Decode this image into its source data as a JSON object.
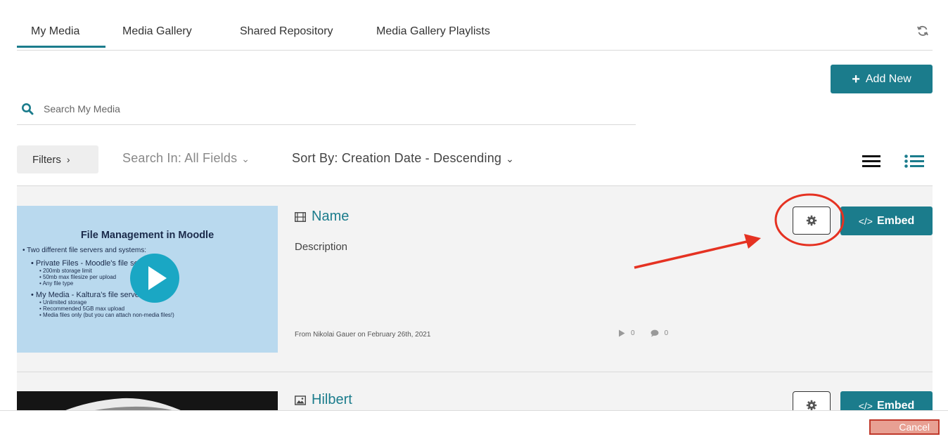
{
  "tabs": [
    {
      "label": "My Media",
      "active": true
    },
    {
      "label": "Media Gallery",
      "active": false
    },
    {
      "label": "Shared Repository",
      "active": false
    },
    {
      "label": "Media Gallery Playlists",
      "active": false
    }
  ],
  "toolbar": {
    "add_new_label": "Add New",
    "search_placeholder": "Search My Media",
    "filters_label": "Filters",
    "search_in_label": "Search In: All Fields",
    "sort_by_label": "Sort By: Creation Date - Descending"
  },
  "media": [
    {
      "title": "Name",
      "type_icon": "video-icon",
      "description": "Description",
      "from_text": "From Nikolai Gauer on February 26th, 2021",
      "plays": "0",
      "comments": "0",
      "embed_label": "Embed",
      "thumbnail": {
        "slide_title": "File Management in Moodle",
        "lines": [
          {
            "level": 1,
            "text": "Two different file servers and systems:"
          },
          {
            "level": 2,
            "text": "Private Files - Moodle's file server"
          },
          {
            "level": 3,
            "text": "200mb storage limit"
          },
          {
            "level": 3,
            "text": "50mb max filesize per upload"
          },
          {
            "level": 3,
            "text": "Any file type"
          },
          {
            "level": 2,
            "text": "My Media - Kaltura's file server"
          },
          {
            "level": 3,
            "text": "Unlimited storage"
          },
          {
            "level": 3,
            "text": "Recommended 5GB max upload"
          },
          {
            "level": 3,
            "text": "Media files only (but you can attach non-media files!)"
          }
        ]
      }
    },
    {
      "title": "Hilbert",
      "type_icon": "image-icon",
      "embed_label": "Embed"
    }
  ],
  "footer": {
    "cancel_label": "Cancel"
  },
  "colors": {
    "accent": "#1b7c8c",
    "annotation": "#e53222"
  }
}
